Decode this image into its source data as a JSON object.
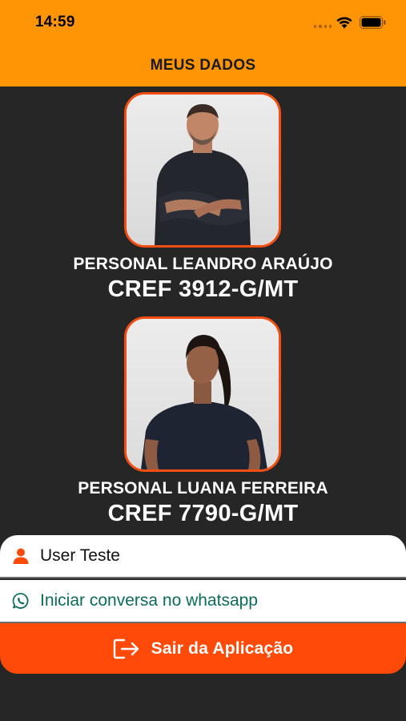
{
  "status_bar": {
    "time": "14:59"
  },
  "header": {
    "title": "MEUS DADOS"
  },
  "profiles": [
    {
      "name": "PERSONAL LEANDRO ARAÚJO",
      "cref": "CREF 3912-G/MT"
    },
    {
      "name": "PERSONAL LUANA FERREIRA",
      "cref": "CREF 7790-G/MT"
    }
  ],
  "user_row": {
    "icon": "user-icon",
    "label": "User Teste"
  },
  "whatsapp_row": {
    "icon": "whatsapp-icon",
    "label": "Iniciar conversa no whatsapp"
  },
  "logout": {
    "icon": "logout-icon",
    "label": "Sair da Aplicação"
  },
  "colors": {
    "header": "#FF9505",
    "background": "#262626",
    "accent": "#FF4A0A",
    "whatsapp_text": "#0E6B5C"
  }
}
